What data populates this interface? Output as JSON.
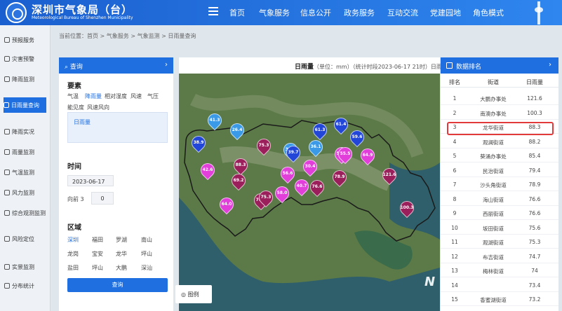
{
  "header": {
    "title_cn": "深圳市气象局（台）",
    "title_en": "Meteorological Bureau of Shenzhen Municipality",
    "nav": [
      "首页",
      "气象服务",
      "信息公开",
      "政务服务",
      "互动交流",
      "党建园地",
      "角色模式"
    ]
  },
  "sidebar": {
    "items": [
      "预报服务",
      "灾害预警",
      "降雨监测",
      "日雨量查询",
      "降雨实况",
      "雨量监测",
      "气温监测",
      "风力监测",
      "综合观测监测",
      "风险定位",
      "实景监测",
      "分布统计"
    ]
  },
  "breadcrumb": "当前位置：首页 > 气象服务 > 气象监测 > 日雨量查询",
  "query_panel": {
    "title": "查询",
    "elements_label": "要素",
    "elements": [
      "气温",
      "降雨量",
      "相对湿度",
      "风速",
      "气压",
      "能见度",
      "风速风向"
    ],
    "selected_element": "日雨量",
    "time_label": "时间",
    "date": "2023-06-17",
    "hour_label": "向前 3",
    "hour_value": "0",
    "region_label": "区域",
    "regions": [
      "深圳",
      "福田",
      "罗湖",
      "南山",
      "龙岗",
      "宝安",
      "龙华",
      "坪山",
      "盐田",
      "坪山",
      "大鹏",
      "深汕"
    ],
    "query_button": "查询"
  },
  "map": {
    "header_title": "日雨量",
    "header_meta": "（单位：mm）（统计时段2023-06-17 21时）日雨量分布",
    "legend_button": "图例",
    "watermark": "N",
    "markers": [
      {
        "label": "41.3",
        "color": "#3a9ae8"
      },
      {
        "label": "26.4",
        "color": "#3a9ae8"
      },
      {
        "label": "38.9",
        "color": "#2246d8"
      },
      {
        "label": "61.3",
        "color": "#2246d8"
      },
      {
        "label": "75.3",
        "color": "#9a1f5a"
      },
      {
        "label": "61.4",
        "color": "#2246d8"
      },
      {
        "label": "36.3",
        "color": "#3a9ae8"
      },
      {
        "label": "59.6",
        "color": "#2246d8"
      },
      {
        "label": "36.1",
        "color": "#3a9ae8"
      },
      {
        "label": "39.7",
        "color": "#2246d8"
      },
      {
        "label": "88.3",
        "color": "#9a1f5a"
      },
      {
        "label": "42.6",
        "color": "#e23ed9"
      },
      {
        "label": "58.9",
        "color": "#e23ed9"
      },
      {
        "label": "30.4",
        "color": "#e23ed9"
      },
      {
        "label": "55.5",
        "color": "#e23ed9"
      },
      {
        "label": "64.9",
        "color": "#e23ed9"
      },
      {
        "label": "69.2",
        "color": "#9a1f5a"
      },
      {
        "label": "56.6",
        "color": "#e23ed9"
      },
      {
        "label": "40.7",
        "color": "#e23ed9"
      },
      {
        "label": "76.6",
        "color": "#9a1f5a"
      },
      {
        "label": "78.9",
        "color": "#9a1f5a"
      },
      {
        "label": "121.6",
        "color": "#9a1f5a"
      },
      {
        "label": "58.0",
        "color": "#e23ed9"
      },
      {
        "label": "76.6",
        "color": "#9a1f5a"
      },
      {
        "label": "75.3",
        "color": "#9a1f5a"
      },
      {
        "label": "64.0",
        "color": "#e23ed9"
      },
      {
        "label": "100.3",
        "color": "#9a1f5a"
      }
    ]
  },
  "ranking": {
    "title": "数据排名",
    "columns": [
      "排名",
      "街道",
      "日雨量"
    ],
    "rows": [
      {
        "rank": "1",
        "name": "大鹏办事处",
        "value": "121.6"
      },
      {
        "rank": "2",
        "name": "南澳办事处",
        "value": "100.3"
      },
      {
        "rank": "3",
        "name": "龙华街道",
        "value": "88.3"
      },
      {
        "rank": "4",
        "name": "观澜街道",
        "value": "88.2"
      },
      {
        "rank": "5",
        "name": "葵涌办事处",
        "value": "85.4"
      },
      {
        "rank": "6",
        "name": "民治街道",
        "value": "79.4"
      },
      {
        "rank": "7",
        "name": "沙头角街道",
        "value": "78.9"
      },
      {
        "rank": "8",
        "name": "海山街道",
        "value": "76.6"
      },
      {
        "rank": "9",
        "name": "西丽街道",
        "value": "76.6"
      },
      {
        "rank": "10",
        "name": "坂田街道",
        "value": "75.6"
      },
      {
        "rank": "11",
        "name": "观湖街道",
        "value": "75.3"
      },
      {
        "rank": "12",
        "name": "布吉街道",
        "value": "74.7"
      },
      {
        "rank": "13",
        "name": "梅林街道",
        "value": "74"
      },
      {
        "rank": "14",
        "name": "",
        "value": "73.4"
      },
      {
        "rank": "15",
        "name": "香蜜湖街道",
        "value": "73.2"
      }
    ]
  }
}
